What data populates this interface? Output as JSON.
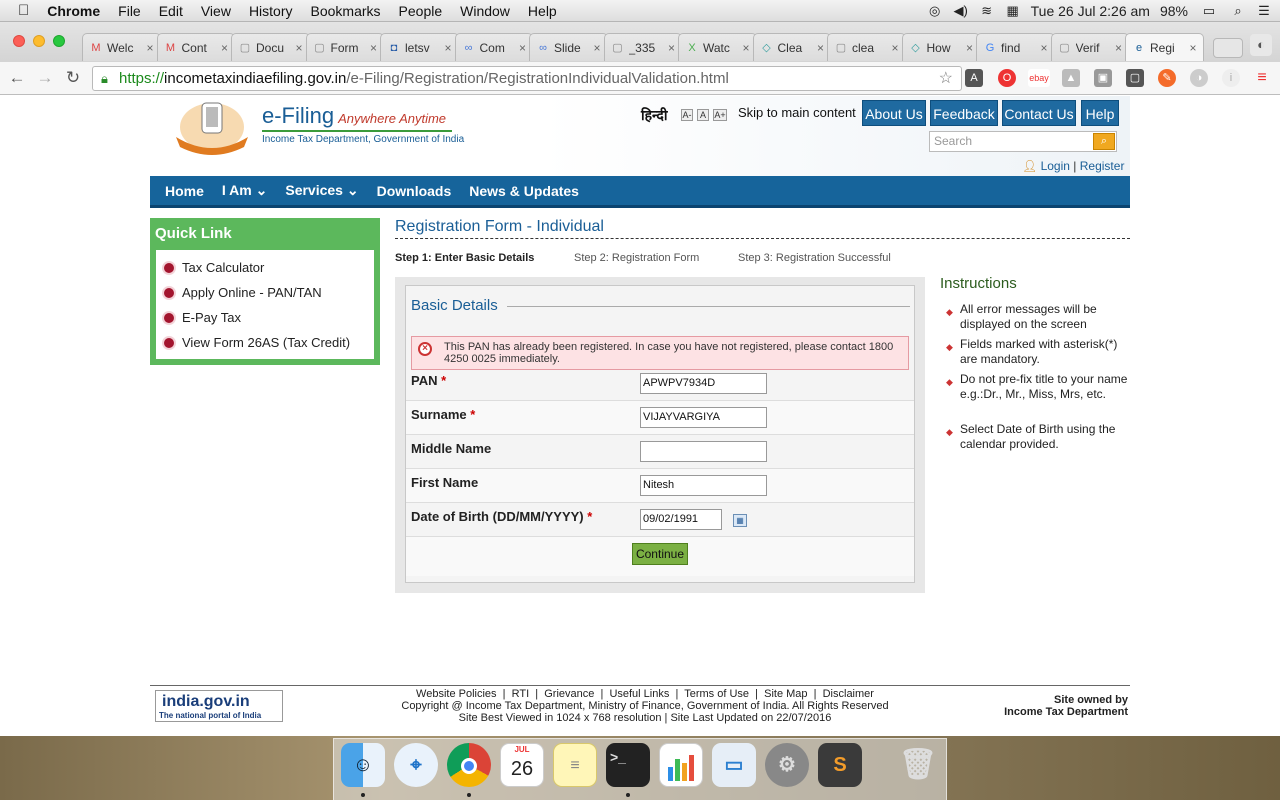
{
  "menubar": {
    "apple": "",
    "app": "Chrome",
    "items": [
      "File",
      "Edit",
      "View",
      "History",
      "Bookmarks",
      "People",
      "Window",
      "Help"
    ],
    "clock": "Tue 26 Jul  2:26 am",
    "battery": "98%"
  },
  "tabs": [
    {
      "icon": "M",
      "title": "Welc",
      "color": "#d44"
    },
    {
      "icon": "M",
      "title": "Cont",
      "color": "#d44"
    },
    {
      "icon": "▢",
      "title": "Docu",
      "color": "#888"
    },
    {
      "icon": "▢",
      "title": "Form",
      "color": "#888"
    },
    {
      "icon": "◘",
      "title": "letsv",
      "color": "#2a5ea8"
    },
    {
      "icon": "∞",
      "title": "Com",
      "color": "#4a7ad8"
    },
    {
      "icon": "∞",
      "title": "Slide",
      "color": "#4a7ad8"
    },
    {
      "icon": "▢",
      "title": "_335",
      "color": "#888"
    },
    {
      "icon": "X",
      "title": "Watc",
      "color": "#4caf50"
    },
    {
      "icon": "◇",
      "title": "Clea",
      "color": "#3aa0a0"
    },
    {
      "icon": "▢",
      "title": "clea",
      "color": "#888"
    },
    {
      "icon": "◇",
      "title": "How",
      "color": "#3aa0a0"
    },
    {
      "icon": "G",
      "title": "find",
      "color": "#4285f4"
    },
    {
      "icon": "▢",
      "title": "Verif",
      "color": "#888"
    },
    {
      "icon": "e",
      "title": "Regi",
      "color": "#1a5e96"
    }
  ],
  "url": {
    "scheme": "https://",
    "host": "incometaxindiaefiling.gov.in",
    "path": "/e-Filing/Registration/RegistrationIndividualValidation.html"
  },
  "header": {
    "brand": "e-Filing",
    "tagline": "Anywhere Anytime",
    "subtitle": "Income Tax Department, Government of India",
    "hindi": "हिन्दी",
    "font_sizes": [
      "A-",
      "A",
      "A+"
    ],
    "skip": "Skip to main content",
    "top_buttons": [
      "About Us",
      "Feedback",
      "Contact Us",
      "Help"
    ],
    "search_placeholder": "Search",
    "login": "Login",
    "register": "Register"
  },
  "nav": [
    "Home",
    "I Am ⌄",
    "Services ⌄",
    "Downloads",
    "News & Updates"
  ],
  "quick_link": {
    "title": "Quick Link",
    "items": [
      "Tax Calculator",
      "Apply Online - PAN/TAN",
      "E-Pay Tax",
      "View Form 26AS (Tax Credit)"
    ]
  },
  "form": {
    "title": "Registration Form - Individual",
    "steps": [
      "Step 1: Enter Basic Details",
      "Step 2: Registration Form",
      "Step 3: Registration Successful"
    ],
    "section": "Basic Details",
    "error": "This PAN has already been registered. In case you have not registered, please contact 1800 4250 0025 immediately.",
    "fields": [
      {
        "label": "PAN",
        "required": true,
        "value": "APWPV7934D"
      },
      {
        "label": "Surname",
        "required": true,
        "value": "VIJAYVARGIYA"
      },
      {
        "label": "Middle Name",
        "required": false,
        "value": ""
      },
      {
        "label": "First Name",
        "required": false,
        "value": "Nitesh"
      },
      {
        "label": "Date of Birth (DD/MM/YYYY)",
        "required": true,
        "value": "09/02/1991"
      }
    ],
    "continue": "Continue"
  },
  "instructions": {
    "title": "Instructions",
    "items": [
      "All error messages will be displayed on the screen",
      "Fields marked with asterisk(*) are mandatory.",
      "Do not pre-fix title to your name e.g.:Dr., Mr., Miss, Mrs, etc.",
      "Select Date of Birth using the calendar provided."
    ]
  },
  "footer": {
    "logo_main": "india.gov.in",
    "logo_sub": "The national portal of India",
    "links": "Website Policies  |  RTI  |  Grievance  |  Useful Links  |  Terms of Use  |  Site Map  |  Disclaimer",
    "copyright": "Copyright @ Income Tax Department, Ministry of Finance, Government of India. All Rights Reserved",
    "best_viewed": "Site Best Viewed in 1024 x 768 resolution | Site Last Updated on 22/07/2016",
    "owned_1": "Site owned by",
    "owned_2": "Income Tax Department"
  },
  "dock": {
    "calendar_month": "JUL",
    "calendar_day": "26"
  }
}
